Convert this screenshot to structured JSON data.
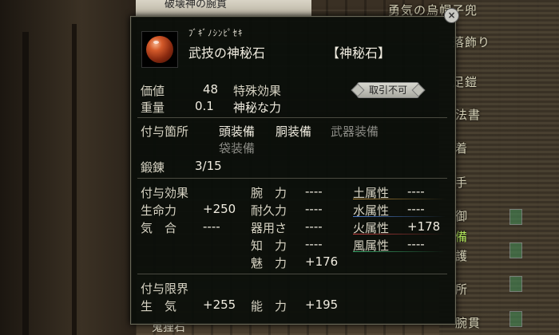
{
  "background": {
    "top_text": "破壊神の腕貫",
    "list_items": [
      {
        "label": "勇気の烏帽子兜"
      },
      {
        "label": "落飾り"
      },
      {
        "label": "足鎧"
      },
      {
        "label": "法書"
      },
      {
        "label": "着"
      },
      {
        "label": "手"
      },
      {
        "label": "御"
      },
      {
        "label": "備"
      },
      {
        "label": "護"
      },
      {
        "label": "所"
      },
      {
        "label": "腕貫"
      }
    ],
    "bottom_item": "鬼狸石"
  },
  "tooltip": {
    "close_symbol": "×",
    "ruby": "ﾌﾞｷﾞﾉｼﾝﾋﾟｾｷ",
    "item_name": "武技の神秘石",
    "category": "【神秘石】",
    "value_label": "価値",
    "value": "48",
    "weight_label": "重量",
    "weight": "0.1",
    "special_label": "特殊効果",
    "special_value": "神秘な力",
    "trade_badge": "取引不可",
    "attach_label": "付与箇所",
    "attach_slots": {
      "head": "頭装備",
      "body": "胴装備",
      "weapon": "武器装備",
      "bag": "袋装備"
    },
    "forge_label": "鍛錬",
    "forge_value": "3/15",
    "effects_label": "付与効果",
    "effects": {
      "hp_label": "生命力",
      "hp": "+250",
      "ki_label": "気　合",
      "ki": "----",
      "arm_label": "腕　力",
      "arm": "----",
      "dur_label": "耐久力",
      "dur": "----",
      "dex_label": "器用さ",
      "dex": "----",
      "int_label": "知　力",
      "int": "----",
      "cha_label": "魅　力",
      "cha": "+176",
      "earth_label": "土属性",
      "earth": "----",
      "water_label": "水属性",
      "water": "----",
      "fire_label": "火属性",
      "fire": "+178",
      "wind_label": "風属性",
      "wind": "----"
    },
    "limits_label": "付与限界",
    "limits": {
      "life_label": "生　気",
      "life": "+255",
      "ability_label": "能　力",
      "ability": "+195"
    }
  },
  "colors": {
    "panel_bg": "#0a0e0a",
    "earth": "#b88c3a",
    "water": "#4a78c8",
    "fire": "#c84040",
    "wind": "#3aa86a"
  }
}
